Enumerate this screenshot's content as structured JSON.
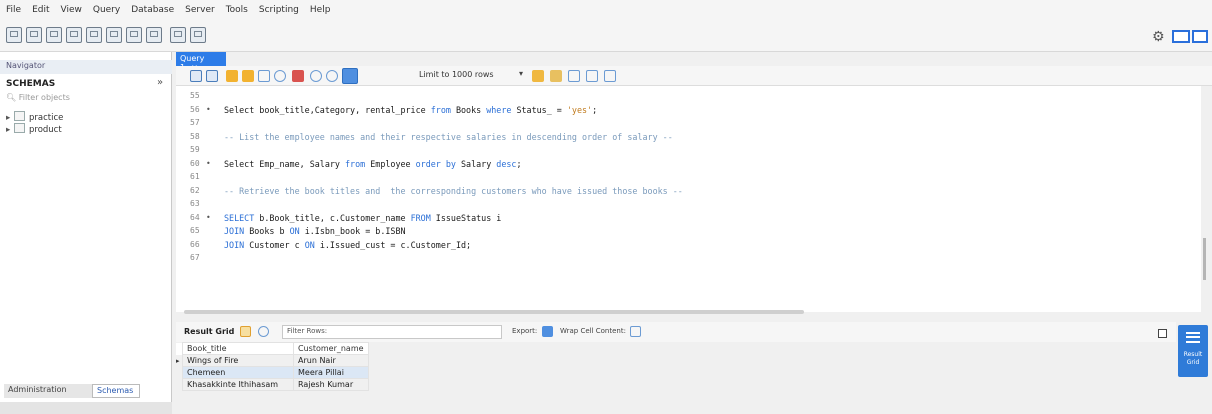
{
  "menu": [
    "File",
    "Edit",
    "View",
    "Query",
    "Database",
    "Server",
    "Tools",
    "Scripting",
    "Help"
  ],
  "navigator": {
    "title": "Navigator",
    "schemas_label": "SCHEMAS",
    "collapse_glyph": "»",
    "filter_placeholder": "Filter objects",
    "schemas": [
      "practice",
      "product"
    ],
    "bottom_tabs": {
      "administration": "Administration",
      "schemas": "Schemas"
    }
  },
  "editor": {
    "tab_label": "Query 1",
    "tab_close": "×",
    "limit_label": "Limit to 1000 rows",
    "lines": [
      {
        "num": "55",
        "marker": "",
        "segments": []
      },
      {
        "num": "56",
        "marker": "•",
        "segments": [
          {
            "t": "Select book_title,Category, rental_price ",
            "c": ""
          },
          {
            "t": "from",
            "c": "kw"
          },
          {
            "t": " Books ",
            "c": ""
          },
          {
            "t": "where",
            "c": "kw"
          },
          {
            "t": " Status_ = ",
            "c": ""
          },
          {
            "t": "'yes'",
            "c": "str"
          },
          {
            "t": ";",
            "c": ""
          }
        ]
      },
      {
        "num": "57",
        "marker": "",
        "segments": []
      },
      {
        "num": "58",
        "marker": "",
        "segments": [
          {
            "t": "-- List the employee names and their respective salaries in descending order of salary --",
            "c": "cm"
          }
        ]
      },
      {
        "num": "59",
        "marker": "",
        "segments": []
      },
      {
        "num": "60",
        "marker": "•",
        "segments": [
          {
            "t": "Select Emp_name, Salary ",
            "c": ""
          },
          {
            "t": "from",
            "c": "kw"
          },
          {
            "t": " Employee ",
            "c": ""
          },
          {
            "t": "order by",
            "c": "kw"
          },
          {
            "t": " Salary ",
            "c": ""
          },
          {
            "t": "desc",
            "c": "kw"
          },
          {
            "t": ";",
            "c": ""
          }
        ]
      },
      {
        "num": "61",
        "marker": "",
        "segments": []
      },
      {
        "num": "62",
        "marker": "",
        "segments": [
          {
            "t": "-- Retrieve the book titles and  the corresponding customers who have issued those books --",
            "c": "cm"
          }
        ]
      },
      {
        "num": "63",
        "marker": "",
        "segments": []
      },
      {
        "num": "64",
        "marker": "•",
        "segments": [
          {
            "t": "SELECT",
            "c": "kw"
          },
          {
            "t": " b.Book_title, c.Customer_name ",
            "c": ""
          },
          {
            "t": "FROM",
            "c": "kw"
          },
          {
            "t": " IssueStatus i",
            "c": ""
          }
        ]
      },
      {
        "num": "65",
        "marker": "",
        "segments": [
          {
            "t": "JOIN",
            "c": "kw"
          },
          {
            "t": " Books b ",
            "c": ""
          },
          {
            "t": "ON",
            "c": "kw"
          },
          {
            "t": " i.Isbn_book = b.ISBN",
            "c": ""
          }
        ]
      },
      {
        "num": "66",
        "marker": "",
        "segments": [
          {
            "t": "JOIN",
            "c": "kw"
          },
          {
            "t": " Customer c ",
            "c": ""
          },
          {
            "t": "ON",
            "c": "kw"
          },
          {
            "t": " i.Issued_cust = c.Customer_Id;",
            "c": ""
          }
        ]
      },
      {
        "num": "67",
        "marker": "",
        "segments": []
      }
    ]
  },
  "results": {
    "grid_label": "Result Grid",
    "filter_label": "Filter Rows:",
    "export_label": "Export:",
    "wrap_label": "Wrap Cell Content:",
    "columns": [
      "Book_title",
      "Customer_name"
    ],
    "rows": [
      [
        "Wings of Fire",
        "Arun Nair"
      ],
      [
        "Chemeen",
        "Meera Pillai"
      ],
      [
        "Khasakkinte Ithihasam",
        "Rajesh Kumar"
      ]
    ],
    "current_row_marker": "▸",
    "side_panel_label": "Result Grid"
  },
  "colors": {
    "accent": "#2d7ce8",
    "keyword": "#2b6fd6",
    "string": "#c07a1c",
    "comment": "#7a9abb"
  }
}
